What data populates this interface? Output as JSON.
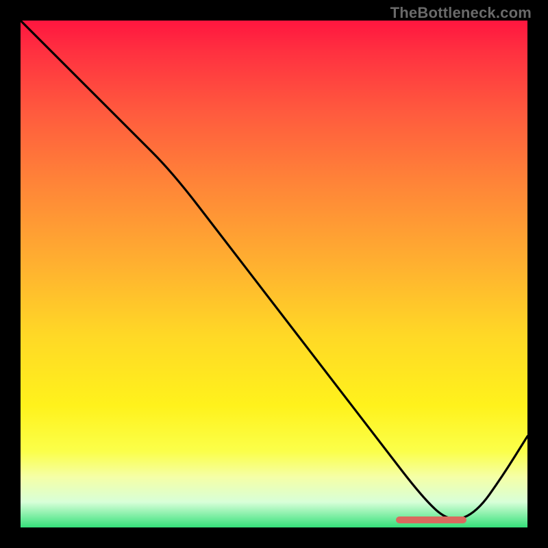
{
  "watermark": "TheBottleneck.com",
  "colors": {
    "page_bg": "#000000",
    "gradient_top": "#ff163f",
    "gradient_mid": "#ffd826",
    "gradient_bottom": "#35e07a",
    "curve": "#000000",
    "marker": "#d96a5e"
  },
  "chart_data": {
    "type": "line",
    "title": "",
    "xlabel": "",
    "ylabel": "",
    "xlim": [
      0,
      100
    ],
    "ylim": [
      0,
      100
    ],
    "x": [
      0,
      10,
      22,
      30,
      40,
      50,
      60,
      70,
      80,
      85,
      90,
      95,
      100
    ],
    "values": [
      100,
      90,
      78,
      70,
      57,
      44,
      31,
      18,
      5,
      1,
      3,
      10,
      18
    ],
    "marker": {
      "x_start": 74,
      "x_end": 88,
      "y": 1.5
    },
    "note": "values are estimated y-positions of the black curve (0=bottom, 100=top); background is a vertical heat gradient from red (top) through yellow to green (bottom); a short horizontal reddish marker sits near the curve minimum"
  }
}
